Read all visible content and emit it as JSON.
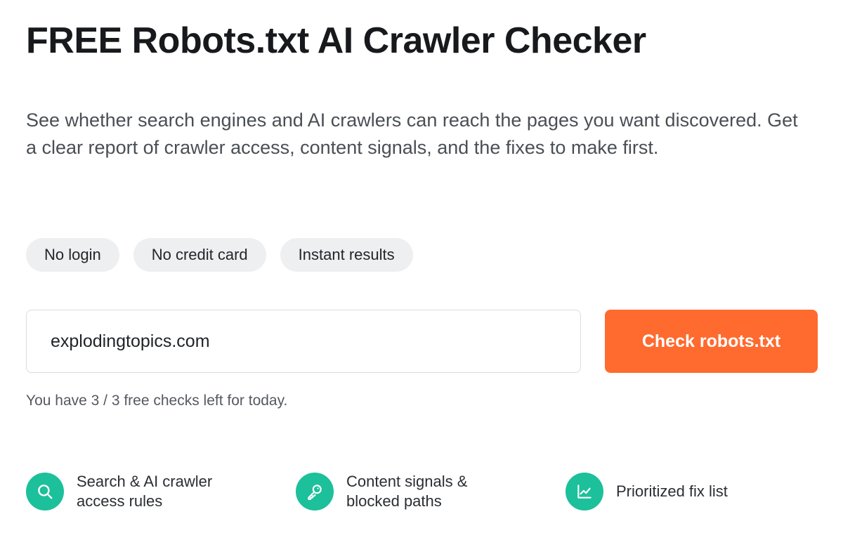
{
  "hero": {
    "title": "FREE Robots.txt AI Crawler Checker",
    "subtitle": "See whether search engines and AI crawlers can reach the pages you want discovered. Get a clear report of crawler access, content signals, and the fixes to make first."
  },
  "chips": [
    {
      "label": "No login"
    },
    {
      "label": "No credit card"
    },
    {
      "label": "Instant results"
    }
  ],
  "form": {
    "domain_value": "explodingtopics.com",
    "button_label": "Check robots.txt",
    "checks_left": "You have 3 / 3 free checks left for today."
  },
  "features": [
    {
      "icon": "search-icon",
      "text": "Search & AI crawler access rules"
    },
    {
      "icon": "key-icon",
      "text": "Content signals & blocked paths"
    },
    {
      "icon": "line-chart-icon",
      "text": "Prioritized fix list"
    }
  ],
  "colors": {
    "accent": "#ff6a2f",
    "feature_icon_bg": "#1cc09a",
    "chip_bg": "#eeeff1"
  }
}
